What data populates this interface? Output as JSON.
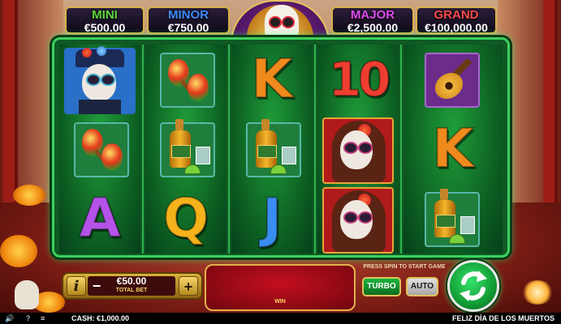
{
  "jackpots": [
    {
      "label": "MINI",
      "value": "€500.00",
      "color": "#5fd83a"
    },
    {
      "label": "MINOR",
      "value": "€750.00",
      "color": "#3f8bff"
    },
    {
      "label": "MAJOR",
      "value": "€2,500.00",
      "color": "#e04cf0"
    },
    {
      "label": "GRAND",
      "value": "€100,000.00",
      "color": "#ff4a4a"
    }
  ],
  "reels": [
    [
      "sugar-skull-man",
      "maracas",
      "letter-a"
    ],
    [
      "maracas",
      "tequila",
      "letter-q"
    ],
    [
      "letter-k",
      "tequila",
      "letter-j"
    ],
    [
      "letter-10",
      "catrina-woman",
      "catrina-woman"
    ],
    [
      "guitar",
      "letter-k",
      "tequila"
    ]
  ],
  "letters": {
    "A": "A",
    "Q": "Q",
    "K": "K",
    "J": "J",
    "TEN": "10"
  },
  "letter_colors": {
    "A": "#b553e8",
    "Q": "#f6b21a",
    "K": "#f08a1c",
    "J": "#3a8df0",
    "TEN": "#ef3e2f"
  },
  "controls": {
    "info": "i",
    "minus": "−",
    "plus": "+",
    "bet_value": "€50.00",
    "bet_label": "TOTAL BET",
    "win_label": "WIN",
    "hint": "PRESS SPIN TO START GAME",
    "turbo": "TURBO",
    "auto": "AUTO"
  },
  "status": {
    "sound": "🔊",
    "help": "?",
    "menu": "≡",
    "cash": "CASH:  €1,000.00",
    "game_title": "FELIZ DÍA DE LOS MUERTOS"
  }
}
